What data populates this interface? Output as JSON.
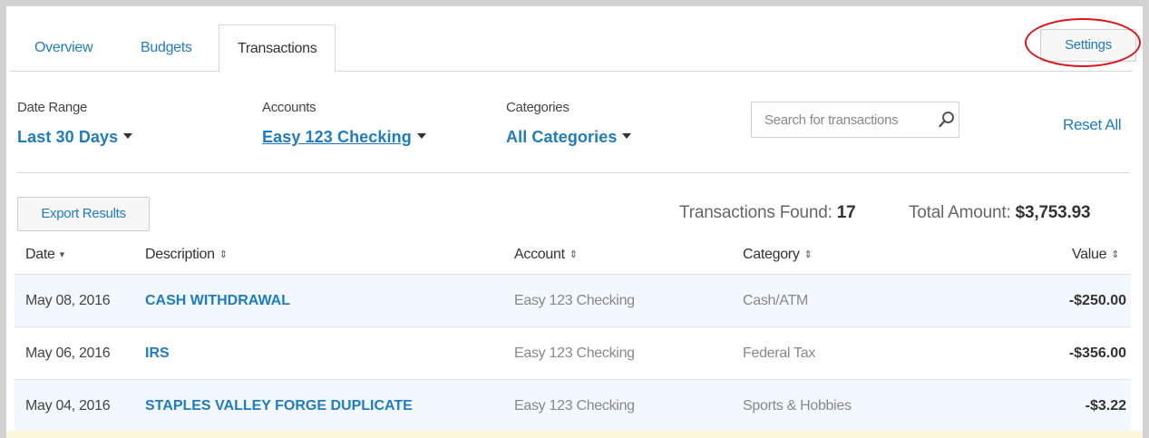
{
  "tabs": [
    {
      "label": "Overview"
    },
    {
      "label": "Budgets"
    },
    {
      "label": "Transactions"
    }
  ],
  "settings_label": "Settings",
  "filters": {
    "date_range": {
      "label": "Date Range",
      "value": "Last 30 Days"
    },
    "accounts": {
      "label": "Accounts",
      "value": "Easy 123 Checking"
    },
    "categories": {
      "label": "Categories",
      "value": "All Categories"
    }
  },
  "search": {
    "placeholder": "Search for transactions"
  },
  "reset_label": "Reset All",
  "export_label": "Export Results",
  "summary": {
    "found_label": "Transactions Found:",
    "found_count": "17",
    "total_label": "Total Amount:",
    "total_value": "$3,753.93"
  },
  "table": {
    "headers": [
      "Date",
      "Description",
      "Account",
      "Category",
      "Value"
    ],
    "rows": [
      {
        "date": "May 08, 2016",
        "description": "CASH WITHDRAWAL",
        "account": "Easy 123 Checking",
        "category": "Cash/ATM",
        "value": "-$250.00"
      },
      {
        "date": "May 06, 2016",
        "description": "IRS",
        "account": "Easy 123 Checking",
        "category": "Federal Tax",
        "value": "-$356.00"
      },
      {
        "date": "May 04, 2016",
        "description": "STAPLES VALLEY FORGE DUPLICATE",
        "account": "Easy 123 Checking",
        "category": "Sports & Hobbies",
        "value": "-$3.22"
      }
    ]
  },
  "colors": {
    "link": "#1f7cc1",
    "highlight_ring": "#e0141b",
    "row_alt": "#f2f8fd"
  },
  "icons": [
    "caret-down-icon",
    "search-icon",
    "sort-desc-icon",
    "sort-both-icon"
  ]
}
